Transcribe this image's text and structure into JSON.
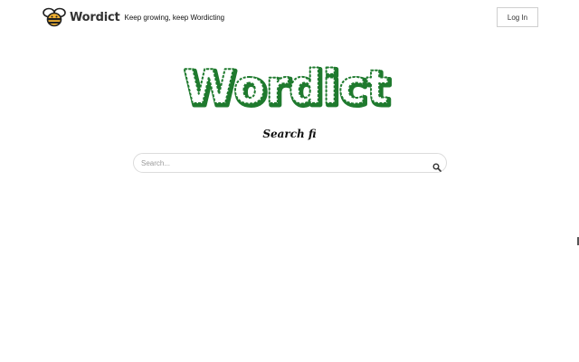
{
  "header": {
    "brand_name": "Wordict",
    "tagline": "Keep growing, keep Wordicting",
    "login_label": "Log In",
    "logo_icon": "bee-icon"
  },
  "hero": {
    "logo_text": "Wordict",
    "subtitle": "Search fi"
  },
  "search": {
    "placeholder": "Search...",
    "value": "",
    "icon": "search-icon"
  },
  "colors": {
    "logo_green": "#1f7a2e",
    "bee_yellow": "#f2b233",
    "bee_dark": "#222222"
  }
}
